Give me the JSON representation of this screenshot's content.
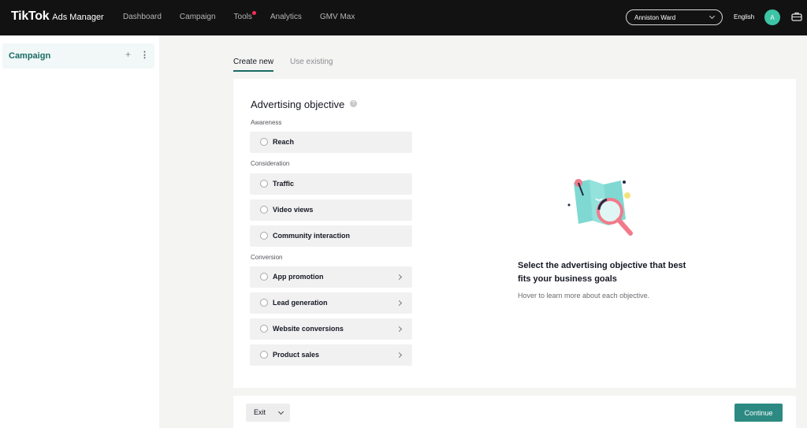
{
  "brand": {
    "logo": "TikTok",
    "sub": "Ads Manager"
  },
  "nav": {
    "items": [
      "Dashboard",
      "Campaign",
      "Tools",
      "Analytics",
      "GMV Max"
    ]
  },
  "header": {
    "account_name": "Anniston Ward",
    "language": "English",
    "avatar_initial": "A"
  },
  "sidebar": {
    "item_label": "Campaign",
    "add_glyph": "+",
    "more_glyph": "⋮"
  },
  "tabs": {
    "create": "Create new",
    "use_existing": "Use existing"
  },
  "objective": {
    "title": "Advertising objective",
    "help_glyph": "?",
    "groups": [
      {
        "label": "Awareness",
        "options": [
          "Reach"
        ]
      },
      {
        "label": "Consideration",
        "options": [
          "Traffic",
          "Video views",
          "Community interaction"
        ]
      },
      {
        "label": "Conversion",
        "options": [
          "App promotion",
          "Lead generation",
          "Website conversions",
          "Product sales"
        ]
      }
    ]
  },
  "help_panel": {
    "title": "Select the advertising objective that best fits your business goals",
    "subtitle": "Hover to learn more about each objective."
  },
  "footer": {
    "exit_label": "Exit",
    "continue_label": "Continue"
  },
  "colors": {
    "accent": "#2c8a82",
    "topbar": "#121212",
    "notify_dot": "#fe2c55",
    "avatar": "#3dc4a6"
  },
  "icons": [
    "help-icon",
    "chevron-down-icon",
    "chevron-right-icon",
    "briefcase-icon",
    "plus-icon",
    "more-icon",
    "map-magnifier-illustration"
  ]
}
